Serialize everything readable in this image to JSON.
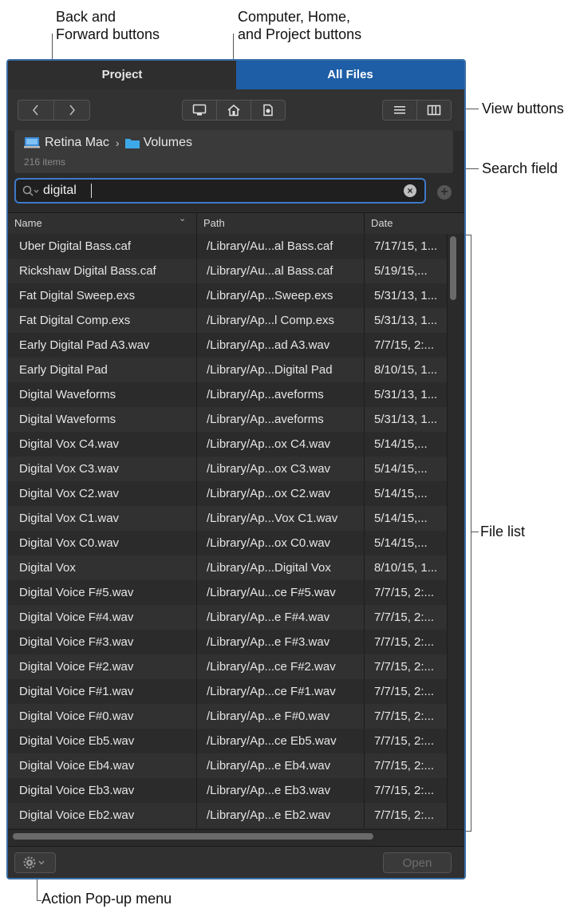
{
  "callouts": {
    "back_forward_line1": "Back and",
    "back_forward_line2": "Forward buttons",
    "cph_line1": "Computer, Home,",
    "cph_line2": "and Project buttons",
    "view_buttons": "View buttons",
    "search_field": "Search field",
    "file_list": "File list",
    "action_menu": "Action Pop-up menu"
  },
  "tabs": [
    {
      "label": "Project"
    },
    {
      "label": "All Files"
    }
  ],
  "path": {
    "computer": "Retina Mac",
    "separator": "›",
    "folder": "Volumes",
    "count": "216 items"
  },
  "search": {
    "value": "digital"
  },
  "columns": {
    "name": "Name",
    "path": "Path",
    "date": "Date"
  },
  "rows": [
    {
      "name": "Uber Digital Bass.caf",
      "path": "/Library/Au...al Bass.caf",
      "date": "7/17/15, 1..."
    },
    {
      "name": "Rickshaw Digital Bass.caf",
      "path": "/Library/Au...al Bass.caf",
      "date": "5/19/15,..."
    },
    {
      "name": "Fat Digital Sweep.exs",
      "path": "/Library/Ap...Sweep.exs",
      "date": "5/31/13, 1..."
    },
    {
      "name": "Fat Digital Comp.exs",
      "path": "/Library/Ap...l Comp.exs",
      "date": "5/31/13, 1..."
    },
    {
      "name": "Early Digital Pad A3.wav",
      "path": "/Library/Ap...ad A3.wav",
      "date": "7/7/15, 2:..."
    },
    {
      "name": "Early Digital Pad",
      "path": "/Library/Ap...Digital Pad",
      "date": "8/10/15, 1..."
    },
    {
      "name": "Digital Waveforms",
      "path": "/Library/Ap...aveforms",
      "date": "5/31/13, 1..."
    },
    {
      "name": "Digital Waveforms",
      "path": "/Library/Ap...aveforms",
      "date": "5/31/13, 1..."
    },
    {
      "name": "Digital Vox C4.wav",
      "path": "/Library/Ap...ox C4.wav",
      "date": "5/14/15,..."
    },
    {
      "name": "Digital Vox C3.wav",
      "path": "/Library/Ap...ox C3.wav",
      "date": "5/14/15,..."
    },
    {
      "name": "Digital Vox C2.wav",
      "path": "/Library/Ap...ox C2.wav",
      "date": "5/14/15,..."
    },
    {
      "name": "Digital Vox C1.wav",
      "path": "/Library/Ap...Vox C1.wav",
      "date": "5/14/15,..."
    },
    {
      "name": "Digital Vox C0.wav",
      "path": "/Library/Ap...ox C0.wav",
      "date": "5/14/15,..."
    },
    {
      "name": "Digital Vox",
      "path": "/Library/Ap...Digital Vox",
      "date": "8/10/15, 1..."
    },
    {
      "name": "Digital Voice F#5.wav",
      "path": "/Library/Au...ce F#5.wav",
      "date": "7/7/15, 2:..."
    },
    {
      "name": "Digital Voice F#4.wav",
      "path": "/Library/Ap...e F#4.wav",
      "date": "7/7/15, 2:..."
    },
    {
      "name": "Digital Voice F#3.wav",
      "path": "/Library/Ap...e F#3.wav",
      "date": "7/7/15, 2:..."
    },
    {
      "name": "Digital Voice F#2.wav",
      "path": "/Library/Ap...ce F#2.wav",
      "date": "7/7/15, 2:..."
    },
    {
      "name": "Digital Voice F#1.wav",
      "path": "/Library/Ap...ce F#1.wav",
      "date": "7/7/15, 2:..."
    },
    {
      "name": "Digital Voice F#0.wav",
      "path": "/Library/Ap...e F#0.wav",
      "date": "7/7/15, 2:..."
    },
    {
      "name": "Digital Voice Eb5.wav",
      "path": "/Library/Ap...ce Eb5.wav",
      "date": "7/7/15, 2:..."
    },
    {
      "name": "Digital Voice Eb4.wav",
      "path": "/Library/Ap...e Eb4.wav",
      "date": "7/7/15, 2:..."
    },
    {
      "name": "Digital Voice Eb3.wav",
      "path": "/Library/Ap...e Eb3.wav",
      "date": "7/7/15, 2:..."
    },
    {
      "name": "Digital Voice Eb2.wav",
      "path": "/Library/Ap...e Eb2.wav",
      "date": "7/7/15, 2:..."
    }
  ],
  "footer": {
    "open_label": "Open"
  },
  "colors": {
    "accent": "#1e5ea6",
    "panel_bg": "#2b2b2b",
    "focus_ring": "#3d79c9"
  },
  "icons": [
    "chevron-left-icon",
    "chevron-right-icon",
    "computer-icon",
    "home-icon",
    "project-icon",
    "list-view-icon",
    "column-view-icon",
    "search-icon",
    "clear-icon",
    "add-icon",
    "gear-icon"
  ]
}
